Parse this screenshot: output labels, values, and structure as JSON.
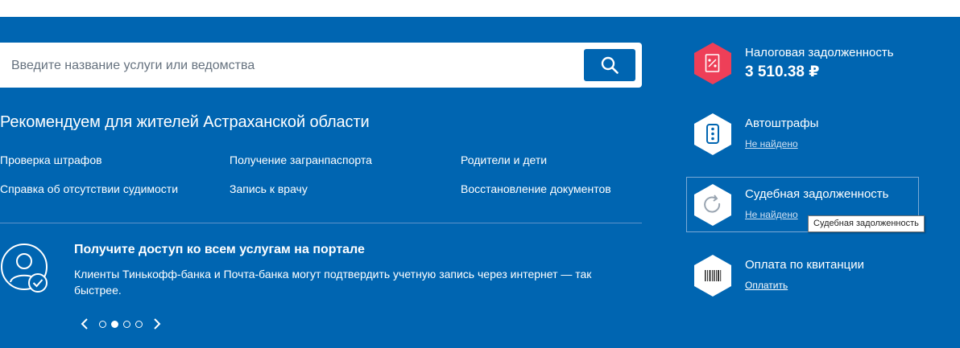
{
  "search": {
    "placeholder": "Введите название услуги или ведомства",
    "value": ""
  },
  "recommendations": {
    "title": "Рекомендуем для жителей Астраханской области",
    "links": [
      "Проверка штрафов",
      "Получение загранпаспорта",
      "Родители и дети",
      "Справка об отсутствии судимости",
      "Запись к врачу",
      "Восстановление документов"
    ]
  },
  "promo": {
    "title": "Получите доступ ко всем услугам на портале",
    "text": "Клиенты Тинькофф-банка и Почта-банка могут подтвердить учетную запись через интернет — так быстрее.",
    "icon": "user-check-icon"
  },
  "carousel": {
    "total_slides": 4,
    "active_slide": 2
  },
  "services": {
    "tax": {
      "title": "Налоговая задолженность",
      "amount": "3 510.38 ₽",
      "icon": "tax-document-icon",
      "accent": "#ee3f58"
    },
    "fines": {
      "title": "Автоштрафы",
      "status": "Не найдено",
      "icon": "traffic-light-icon"
    },
    "court": {
      "title": "Судебная задолженность",
      "status": "Не найдено",
      "icon": "refresh-icon"
    },
    "receipt": {
      "title": "Оплата по квитанции",
      "link": "Оплатить",
      "icon": "barcode-icon"
    }
  },
  "tooltip": {
    "text": "Судебная задолженность"
  },
  "colors": {
    "background": "#0065b1",
    "accent": "#ee3f58",
    "white": "#ffffff"
  }
}
